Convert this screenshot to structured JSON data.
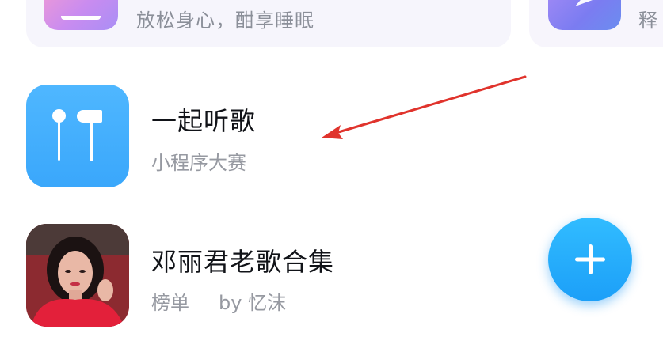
{
  "top_cards": {
    "left_subtitle": "放松身心，酣享睡眠",
    "right_subtitle": "释",
    "left_icon": "sleep-icon",
    "right_icon": "relax-icon"
  },
  "items": [
    {
      "title": "一起听歌",
      "subtitle": "小程序大赛",
      "icon": "earphones-icon"
    },
    {
      "title": "邓丽君老歌合集",
      "subtitle_tag": "榜单",
      "subtitle_author": "by 忆沫",
      "icon": "album-cover"
    }
  ],
  "fab": {
    "icon": "plus-icon"
  },
  "colors": {
    "accent_blue": "#2aa9fb",
    "annotation_red": "#e0332c"
  }
}
